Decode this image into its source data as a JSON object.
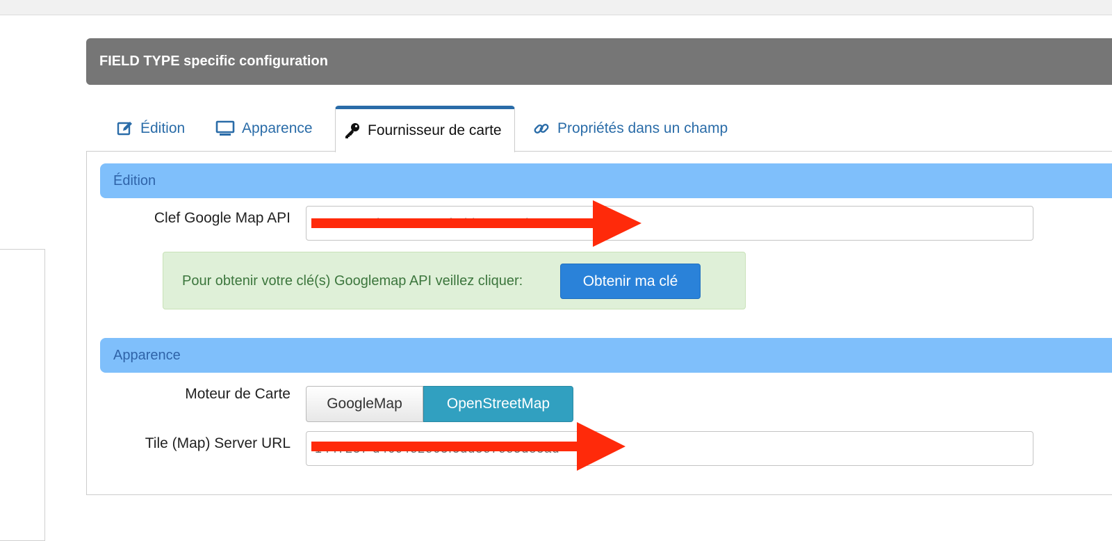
{
  "panel": {
    "title": "FIELD TYPE specific configuration"
  },
  "tabs": [
    {
      "label": "Édition",
      "icon": "edit-icon"
    },
    {
      "label": "Apparence",
      "icon": "monitor-icon"
    },
    {
      "label": "Fournisseur de carte",
      "icon": "key-icon",
      "active": true
    },
    {
      "label": "Propriétés dans un champ",
      "icon": "link-icon"
    }
  ],
  "sections": {
    "edition": {
      "title": "Édition",
      "api_key_label": "Clef Google Map API",
      "api_key_value": "1447237 d46c4e2e63f3dd3e7ee5d83",
      "info_text": "Pour obtenir votre clé(s) Googlemap API veillez cliquer:",
      "info_button": "Obtenir ma clé"
    },
    "apparence": {
      "title": "Apparence",
      "engine_label": "Moteur de Carte",
      "engine_options": [
        "GoogleMap",
        "OpenStreetMap"
      ],
      "engine_selected": "OpenStreetMap",
      "tile_label": "Tile (Map) Server URL",
      "tile_value": "1447237 d46c4e2e63f3dd3e7ee5d83ad"
    }
  },
  "colors": {
    "header_bg": "#767676",
    "tab_accent": "#2a6ca8",
    "section_bg": "#7fbffb",
    "success_bg": "#dff0d8",
    "primary_btn": "#2a82d9",
    "selected_toggle": "#31a0c0",
    "annotation_arrow": "#ff2a0a"
  }
}
